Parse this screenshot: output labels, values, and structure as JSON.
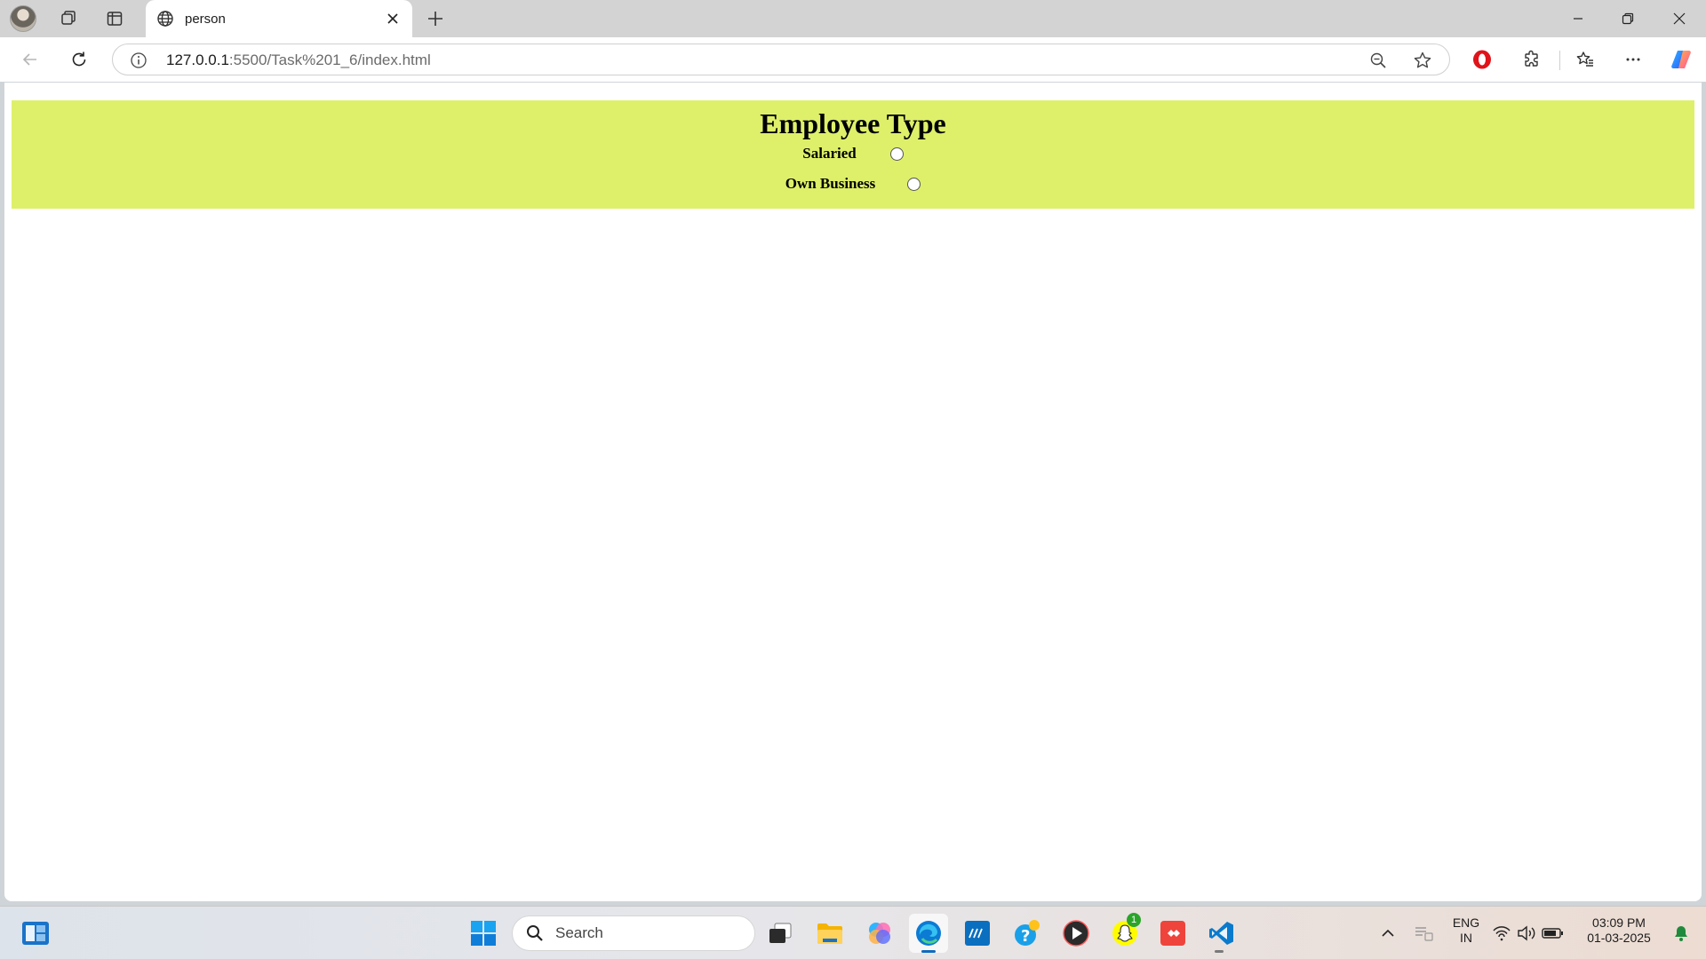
{
  "browser": {
    "tab_title": "person",
    "url_host": "127.0.0.1",
    "url_rest": ":5500/Task%201_6/index.html"
  },
  "page": {
    "heading": "Employee Type",
    "options": [
      {
        "label": "Salaried",
        "checked": false
      },
      {
        "label": "Own Business",
        "checked": false
      }
    ],
    "panel_color": "#def06a"
  },
  "taskbar": {
    "search_label": "Search",
    "language": "ENG",
    "region": "IN",
    "time": "03:09 PM",
    "date": "01-03-2025",
    "snapchat_badge": "1",
    "accent": "#0f6cbd"
  }
}
